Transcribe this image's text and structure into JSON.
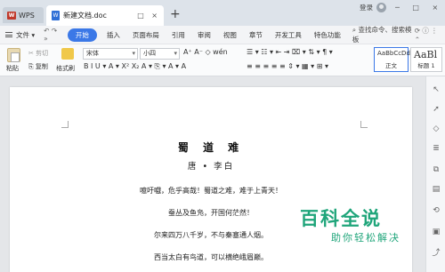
{
  "titlebar": {
    "app_tab": "WPS",
    "doc_tab": "新建文档.doc",
    "doc_tab_controls": "□ ×",
    "new_tab": "+",
    "login": "登录",
    "window_controls": "─ □ ×"
  },
  "menu": {
    "file": "文件",
    "file_arrow": "▾",
    "undo_redo": "↶ ↷ »",
    "items": [
      "开始",
      "插入",
      "页面布局",
      "引用",
      "审阅",
      "视图",
      "章节",
      "开发工具",
      "特色功能"
    ],
    "active": "开始",
    "search": "查找命令、搜索模板",
    "extra_icons": "⟳ ⓘ ⋮ ⌃"
  },
  "ribbon": {
    "paste": "粘贴",
    "cut": "剪切",
    "copy": "复制",
    "format_painter": "格式刷",
    "font_name": "宋体",
    "font_size": "小四",
    "font_row1": "A⁺ A⁻ ◇ wén",
    "font_row2": "B I U ▾ A ▾ X² X₂ A ▾ ⎘ ▾ A ▾ A",
    "para_row1": "☰ ▾ ☷ ▾ ⇤ ⇥ ⌧ ▾ ⇅ ▾ ¶ ▾",
    "para_row2": "≡ ≡ ≡ ≡ ≡ ⇕ ▾ ▦ ▾ ⊞ ▾",
    "styles": [
      {
        "preview": "AaBbCcDd",
        "label": "正文"
      },
      {
        "preview": "AaBl",
        "label": "标题 1"
      }
    ]
  },
  "document": {
    "title": "蜀 道 难",
    "author": "唐 • 李白",
    "lines": [
      "噫吁嚱，危乎高哉！蜀道之难，难于上青天！",
      "蚕丛及鱼凫，开国何茫然！",
      "尔来四万八千岁，不与秦塞通人烟。",
      "西当太白有鸟道，可以横绝峨眉巅。"
    ]
  },
  "watermark": {
    "big": "百科全说",
    "small": "助你轻松解决"
  },
  "sidebar_icons": [
    "cursor-icon",
    "arrow-icon",
    "shape-icon",
    "list-icon",
    "copy-icon",
    "doc-icon",
    "sync-icon",
    "image-icon",
    "share-icon"
  ]
}
